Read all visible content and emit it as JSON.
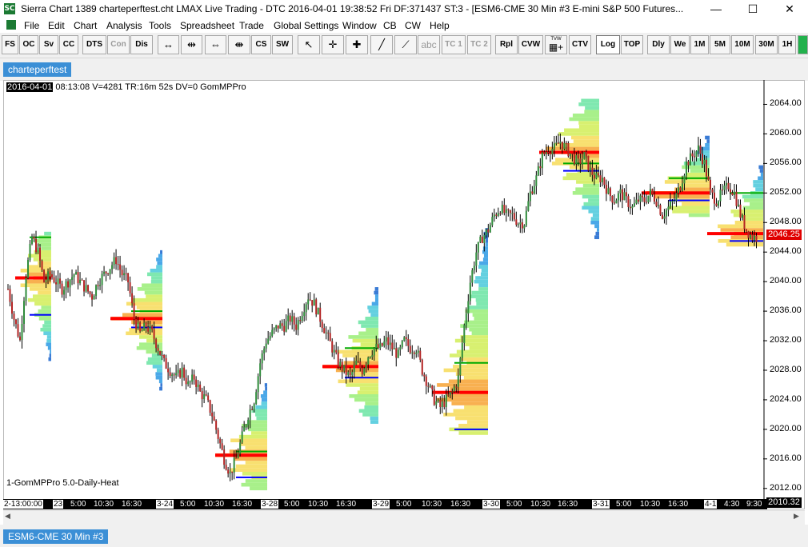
{
  "window": {
    "app_icon": "SC",
    "title": "Sierra Chart 1389 charteperftest.cht  LMAX Live Trading - DTC 2016-04-01  19:38:52 Fri  DF:371437  ST:3 - [ESM6-CME  30 Min  #3  E-mini S&P 500 Futures...",
    "minimize": "—",
    "maximize": "☐",
    "close": "✕"
  },
  "menu": [
    "File",
    "Edit",
    "Chart",
    "Analysis",
    "Tools",
    "Spreadsheet",
    "Trade",
    "Global Settings",
    "Window",
    "CB",
    "CW",
    "Help"
  ],
  "toolbar": {
    "fs": "FS",
    "oc": "OC",
    "sv": "Sv",
    "cc": "CC",
    "dts": "DTS",
    "con": "Con",
    "dis": "Dis",
    "cs": "CS",
    "sw": "SW",
    "abc": "abc",
    "tc1": "TC 1",
    "tc2": "TC 2",
    "rpl": "Rpl",
    "cvw": "CVW",
    "ctv": "CTV",
    "log": "Log",
    "top": "TOP",
    "dly": "Dly",
    "we": "We",
    "m1": "1M",
    "m5": "5M",
    "m10": "10M",
    "m30": "30M",
    "h1": "1H",
    "tvw": "TVW"
  },
  "tabs": {
    "chart_tab": "charteperftest",
    "bottom_tab": "ESM6-CME  30 Min  #3"
  },
  "chart_header": {
    "date": "2016-04-01",
    "info": " 08:13:08 V=4281 TR:16m 52s DV=0  GomMPPro"
  },
  "study_label": "1-GomMPPro 5.0-Daily-Heat",
  "colors": {
    "up": "#2e8b3a",
    "down": "#b22222",
    "last_price": "#e00000",
    "poc": "#ff0000",
    "vah_val": "#0000ff"
  },
  "chart_data": {
    "type": "candlestick",
    "symbol": "ESM6-CME",
    "interval": "30 Min",
    "price_axis": [
      "2064.00",
      "2060.00",
      "2056.00",
      "2052.00",
      "2048.00",
      "2044.00",
      "2040.00",
      "2036.00",
      "2032.00",
      "2028.00",
      "2024.00",
      "2020.00",
      "2016.00",
      "2012.00"
    ],
    "ylim": [
      2011,
      2066
    ],
    "last_price": "2046.25",
    "axis_end_label": "2010.32",
    "time_axis": [
      {
        "label": "2-13:00:00",
        "box": true
      },
      {
        "label": "23",
        "box": true
      },
      {
        "label": "5:00",
        "box": false
      },
      {
        "label": "10:30",
        "box": false
      },
      {
        "label": "16:30",
        "box": false
      },
      {
        "label": "3-24",
        "box": true
      },
      {
        "label": "5:00",
        "box": false
      },
      {
        "label": "10:30",
        "box": false
      },
      {
        "label": "16:30",
        "box": false
      },
      {
        "label": "3-28",
        "box": true
      },
      {
        "label": "5:00",
        "box": false
      },
      {
        "label": "10:30",
        "box": false
      },
      {
        "label": "16:30",
        "box": false
      },
      {
        "label": "3-29",
        "box": true
      },
      {
        "label": "5:00",
        "box": false
      },
      {
        "label": "10:30",
        "box": false
      },
      {
        "label": "16:30",
        "box": false
      },
      {
        "label": "3-30",
        "box": true
      },
      {
        "label": "5:00",
        "box": false
      },
      {
        "label": "10:30",
        "box": false
      },
      {
        "label": "16:30",
        "box": false
      },
      {
        "label": "3-31",
        "box": true
      },
      {
        "label": "5:00",
        "box": false
      },
      {
        "label": "10:30",
        "box": false
      },
      {
        "label": "16:30",
        "box": false
      },
      {
        "label": "4-1",
        "box": true
      },
      {
        "label": "4:30",
        "box": false
      },
      {
        "label": "9:30",
        "box": false
      }
    ],
    "close_path": [
      2039,
      2035,
      2032,
      2041,
      2046,
      2044,
      2040,
      2041,
      2040,
      2039,
      2040,
      2041,
      2040,
      2039,
      2038,
      2040,
      2041,
      2042,
      2043,
      2041,
      2040,
      2035,
      2033,
      2034,
      2033,
      2031,
      2029,
      2028,
      2027,
      2028,
      2026,
      2027,
      2025,
      2024,
      2022,
      2019,
      2016,
      2014,
      2016,
      2019,
      2022,
      2024,
      2029,
      2032,
      2033,
      2034,
      2034,
      2035,
      2034,
      2036,
      2038,
      2037,
      2035,
      2033,
      2031,
      2029,
      2028,
      2027,
      2029,
      2028,
      2030,
      2031,
      2031,
      2032,
      2031,
      2030,
      2032,
      2031,
      2031,
      2028,
      2026,
      2024,
      2023,
      2024,
      2025,
      2027,
      2034,
      2040,
      2044,
      2046,
      2047,
      2049,
      2050,
      2049,
      2049,
      2048,
      2048,
      2052,
      2054,
      2057,
      2058,
      2058,
      2059,
      2058,
      2057,
      2056,
      2057,
      2055,
      2054,
      2054,
      2052,
      2051,
      2052,
      2051,
      2050,
      2051,
      2051,
      2052,
      2051,
      2049,
      2050,
      2051,
      2053,
      2056,
      2057,
      2058,
      2056,
      2052,
      2051,
      2052,
      2053,
      2052,
      2049,
      2047,
      2046,
      2046
    ],
    "profiles": [
      {
        "top": 2046.5,
        "bottom": 2029.5,
        "poc": 2040.5,
        "vah": 2046,
        "val": 2035.5,
        "height": 45
      },
      {
        "top": 2044,
        "bottom": 2025.5,
        "poc": 2035,
        "vah": 2036,
        "val": 2033.8,
        "height": 65
      },
      {
        "top": 2026,
        "bottom": 2012,
        "poc": 2016.5,
        "vah": 2017,
        "val": 2013.5,
        "height": 65
      },
      {
        "top": 2039,
        "bottom": 2021,
        "poc": 2028.5,
        "vah": 2031,
        "val": 2027,
        "height": 70
      },
      {
        "top": 2047,
        "bottom": 2019.5,
        "poc": 2025,
        "vah": 2029,
        "val": 2020,
        "height": 70
      },
      {
        "top": 2064.5,
        "bottom": 2046,
        "poc": 2057.5,
        "vah": 2056,
        "val": 2055,
        "height": 75
      },
      {
        "top": 2059.5,
        "bottom": 2049,
        "poc": 2052,
        "vah": 2054,
        "val": 2051,
        "height": 85
      },
      {
        "top": 2055.5,
        "bottom": 2045,
        "poc": 2046.5,
        "vah": 2052,
        "val": 2045.5,
        "height": 70
      }
    ]
  }
}
